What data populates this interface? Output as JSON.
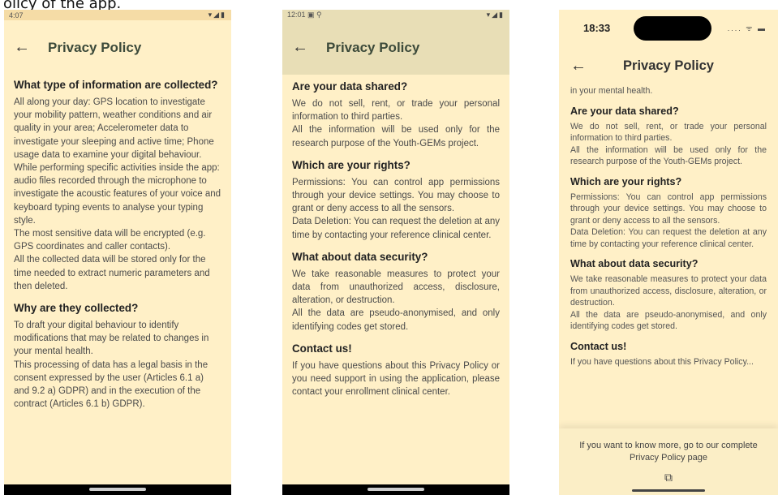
{
  "caption": "olicy of the app.",
  "screen1": {
    "time": "4:07",
    "status_icons": "▾◢▮",
    "back_icon": "←",
    "title": "Privacy Policy",
    "sections": [
      {
        "heading": "What type of information are collected?",
        "text": "All along your day: GPS location to investigate your mobility pattern, weather conditions and air quality in your area; Accelerometer data to investigate your sleeping and active time; Phone usage data to examine your digital behaviour.\nWhile performing specific activities inside the app: audio files recorded through the microphone to investigate the acoustic features of your voice and keyboard typing events to analyse your typing style.\nThe most sensitive data will be encrypted (e.g. GPS coordinates and caller contacts).\nAll the collected data will be stored only for the time needed to extract numeric parameters and then deleted."
      },
      {
        "heading": "Why are they collected?",
        "text": "To draft your digital behaviour to identify modifications that may be related to changes in your mental health.\nThis processing of data has a legal basis in the consent expressed by the user (Articles 6.1 a) and 9.2 a) GDPR) and in the execution of the contract (Articles 6.1 b) GDPR)."
      }
    ]
  },
  "screen2": {
    "time": "12:01",
    "status_extra": "▣ ⚲",
    "status_icons": "▾◢▮",
    "back_icon": "←",
    "title": "Privacy Policy",
    "sections": [
      {
        "heading": "Are your data shared?",
        "text": "We do not sell, rent, or trade your personal information to third parties.\nAll the information will be used only for the research purpose of the Youth-GEMs project."
      },
      {
        "heading": "Which are your rights?",
        "text": "Permissions: You can control app permissions through your device settings. You may choose to grant or deny access to all the sensors.\nData Deletion: You can request the deletion at any time by contacting your reference clinical center."
      },
      {
        "heading": "What about data security?",
        "text": "We take reasonable measures to protect your data from unauthorized access, disclosure, alteration, or destruction.\nAll the data are pseudo-anonymised, and only identifying codes get stored."
      },
      {
        "heading": "Contact us!",
        "text": "If you have questions about this Privacy Policy or you need support in using the application, please contact your enrollment clinical center."
      }
    ]
  },
  "screen3": {
    "time": "18:33",
    "status_icons": "....  ᯤ ▬",
    "back_icon": "←",
    "title": "Privacy Policy",
    "lead_text": "in your mental health.",
    "sections": [
      {
        "heading": "Are your data shared?",
        "text": "We do not sell, rent, or trade your personal information to third parties.\nAll the information will be used only for the research purpose of the Youth-GEMs project."
      },
      {
        "heading": "Which are your rights?",
        "text": "Permissions: You can control app permissions through your device settings. You may choose to grant or deny access to all the sensors.\nData Deletion: You can request the deletion at any time by contacting your reference clinical center."
      },
      {
        "heading": "What about data security?",
        "text": "We take reasonable measures to protect your data from unauthorized access, disclosure, alteration, or destruction.\nAll the data are pseudo-anonymised, and only identifying codes get stored."
      },
      {
        "heading": "Contact us!",
        "text": "If you have questions about this Privacy Policy..."
      }
    ],
    "footer_text": "If you want to know more, go to our complete Privacy Policy page",
    "open_icon": "⧉"
  }
}
